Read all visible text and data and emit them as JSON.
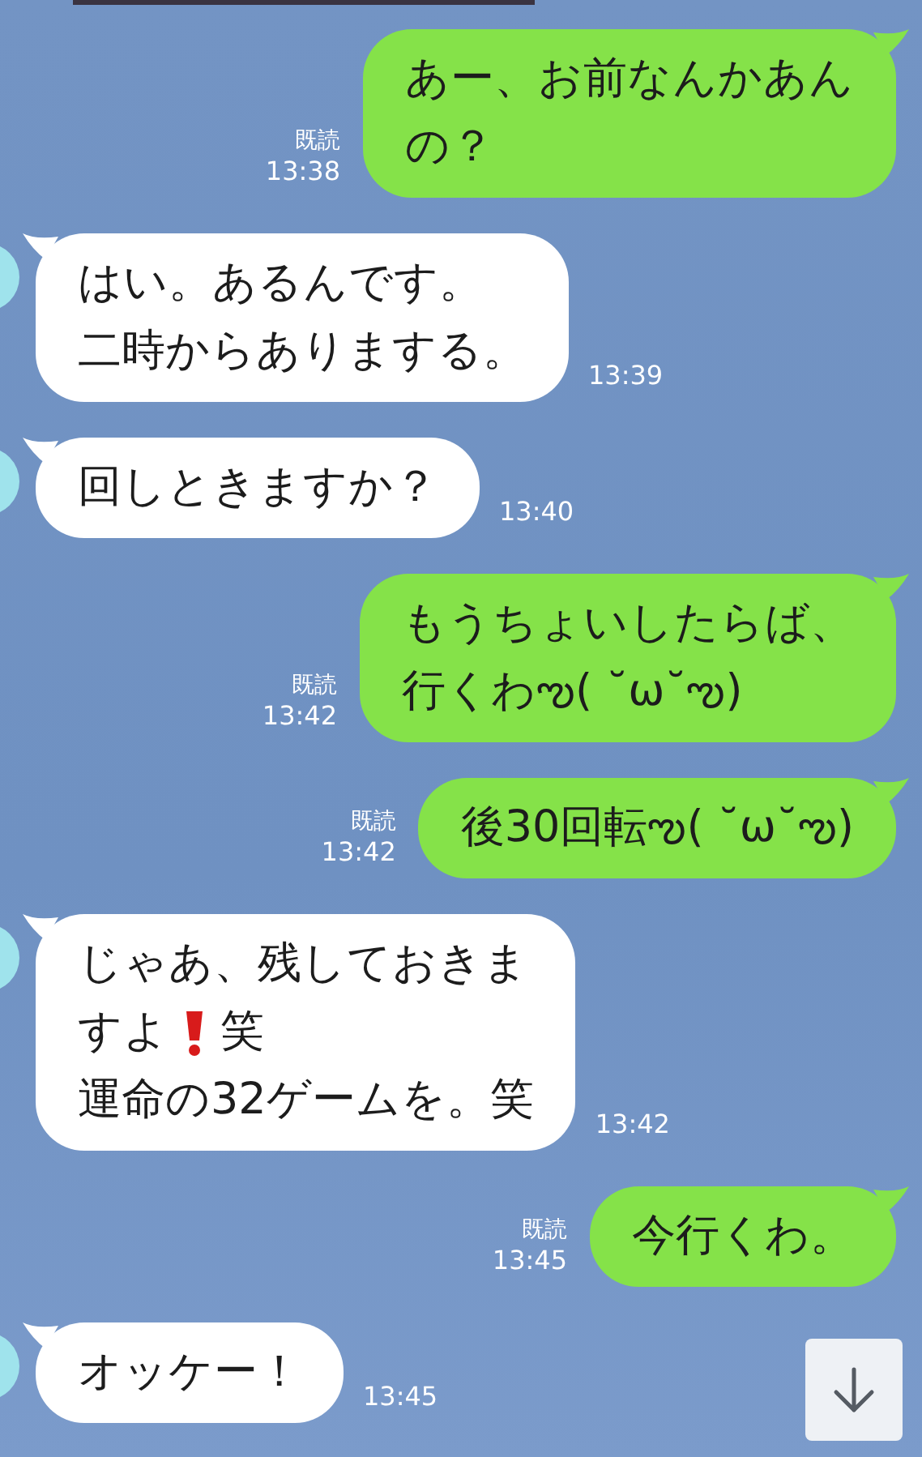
{
  "messages": [
    {
      "kind": "sent",
      "lines": [
        [
          {
            "kind": "text",
            "text": "あー、お前なんかあん"
          }
        ],
        [
          {
            "kind": "text",
            "text": "の？"
          }
        ]
      ],
      "read": "既読",
      "time": "13:38"
    },
    {
      "kind": "received",
      "lines": [
        [
          {
            "kind": "text",
            "text": "はい。あるんです。"
          }
        ],
        [
          {
            "kind": "text",
            "text": "二時からありまする。"
          }
        ]
      ],
      "time": "13:39"
    },
    {
      "kind": "received",
      "lines": [
        [
          {
            "kind": "text",
            "text": "回しときますか？"
          }
        ]
      ],
      "time": "13:40"
    },
    {
      "kind": "sent",
      "lines": [
        [
          {
            "kind": "text",
            "text": "もうちょいしたらば、"
          }
        ],
        [
          {
            "kind": "text",
            "text": "行くわఌ( ˘ω˘ఌ)"
          }
        ]
      ],
      "read": "既読",
      "time": "13:42"
    },
    {
      "kind": "sent",
      "lines": [
        [
          {
            "kind": "text",
            "text": "後30回転ఌ( ˘ω˘ఌ)"
          }
        ]
      ],
      "read": "既読",
      "time": "13:42"
    },
    {
      "kind": "received",
      "lines": [
        [
          {
            "kind": "text",
            "text": "じゃあ、残しておきま"
          }
        ],
        [
          {
            "kind": "text",
            "text": "すよ"
          },
          {
            "kind": "emoji"
          },
          {
            "kind": "text",
            "text": "笑"
          }
        ],
        [
          {
            "kind": "text",
            "text": "運命の32ゲームを。笑"
          }
        ]
      ],
      "time": "13:42"
    },
    {
      "kind": "sent",
      "lines": [
        [
          {
            "kind": "text",
            "text": "今行くわ。"
          }
        ]
      ],
      "read": "既読",
      "time": "13:45"
    },
    {
      "kind": "received",
      "lines": [
        [
          {
            "kind": "text",
            "text": "オッケー！"
          }
        ]
      ],
      "time": "13:45"
    }
  ]
}
